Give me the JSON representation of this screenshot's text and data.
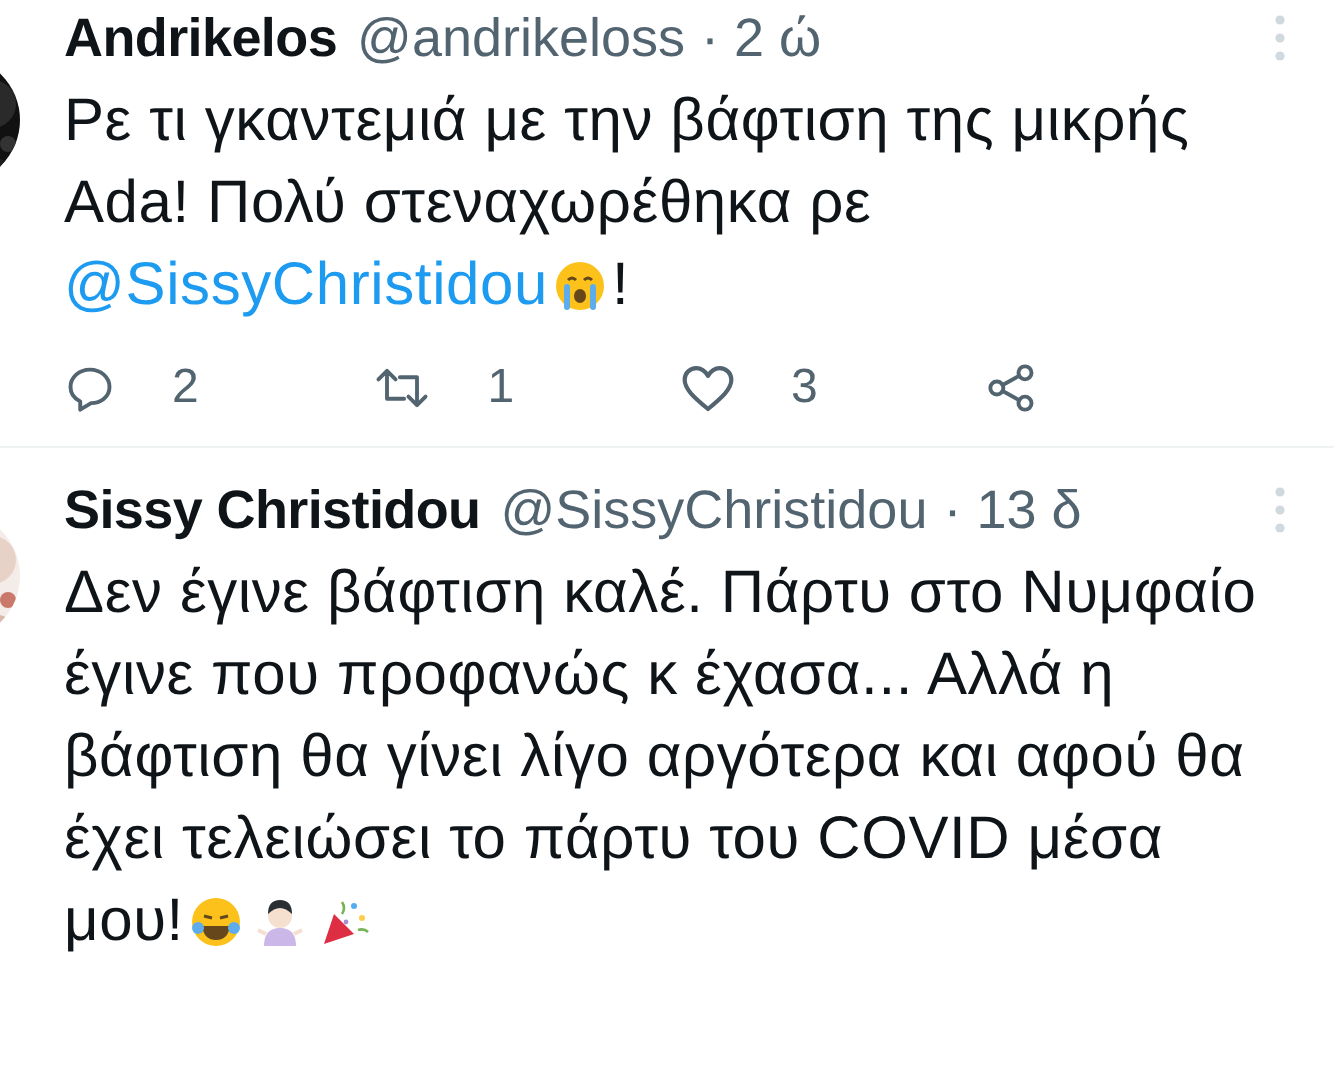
{
  "tweets": [
    {
      "name": "Andrikelos",
      "handle": "@andrikeloss",
      "time": "· 2 ώ",
      "avatar": {
        "kind": "picture"
      },
      "lines": [
        [
          {
            "kind": "text",
            "text": "Ρε τι γκαντεμιά με την βάφτιση της μικρής"
          }
        ],
        [
          {
            "kind": "text",
            "text": "Ada! Πολύ στεναχωρέθηκα ρε"
          }
        ],
        [
          {
            "kind": "mention",
            "text": "@SissyChristidou"
          },
          {
            "kind": "crying"
          },
          {
            "kind": "text",
            "text": "!"
          }
        ]
      ],
      "actions": [
        {
          "kind": "reply",
          "count": "2"
        },
        {
          "kind": "retweet",
          "count": "1"
        },
        {
          "kind": "like",
          "count": "3"
        },
        {
          "kind": "share"
        }
      ]
    },
    {
      "name": "Sissy Christidou",
      "handle": "@SissyChristidou",
      "time": "· 13 δ",
      "avatar": {
        "kind": "picture"
      },
      "lines": [
        [
          {
            "kind": "text",
            "text": "Δεν έγινε βάφτιση καλέ. Πάρτυ στο Νυμφαίο"
          }
        ],
        [
          {
            "kind": "text",
            "text": "έγινε που προφανώς κ έχασα... Αλλά η"
          }
        ],
        [
          {
            "kind": "text",
            "text": "βάφτιση θα γίνει λίγο αργότερα και αφού θα"
          }
        ],
        [
          {
            "kind": "text",
            "text": "έχει τελειώσει το πάρτυ του COVID μέσα"
          }
        ],
        [
          {
            "kind": "text",
            "text": "μου!"
          },
          {
            "kind": "laughing"
          },
          {
            "kind": "shrug"
          },
          {
            "kind": "party"
          }
        ]
      ]
    }
  ]
}
